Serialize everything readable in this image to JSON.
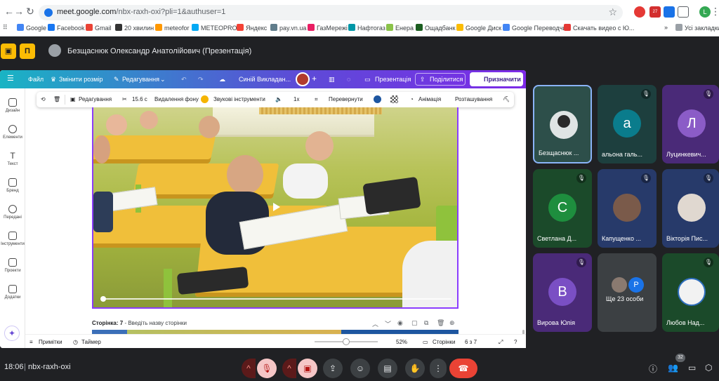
{
  "browser": {
    "url_host": "meet.google.com",
    "url_path": "/nbx-raxh-oxi?pli=1&authuser=1",
    "profile_initial": "L",
    "ext_badge": "27",
    "bookmarks": [
      "Google",
      "Facebook",
      "Gmail",
      "20 хвилин",
      "meteofor",
      "METEOPROG",
      "Яндекс",
      "pay.vn.ua",
      "ГазМережі",
      "Нафтогаз",
      "Енера",
      "Ощадбанк",
      "Google Диск",
      "Google Переводчик",
      "Скачать видео с Ю..."
    ],
    "more_bookmarks": "Усі закладки"
  },
  "meet": {
    "presenter": "Безщаснюк Олександр Анатолійович (Презентація)",
    "time": "18:06",
    "code": "nbx-raxh-oxi",
    "participants_count": "32"
  },
  "canva": {
    "menu": {
      "file": "Файл",
      "resize": "Змінити розмір",
      "edit": "Редагування",
      "project": "Синій Викладан...",
      "present": "Презентація",
      "share": "Поділитися",
      "assign": "Призначити"
    },
    "sidebar": [
      "Дизайн",
      "Елементи",
      "Текст",
      "Бренд",
      "Передані",
      "Інструменти",
      "Проекти",
      "Додатки"
    ],
    "toolbar": {
      "edit": "Редагування",
      "duration": "15.6 с",
      "remove_bg": "Видалення фону",
      "audio": "Звукові інструменти",
      "speed": "1x",
      "flip": "Перевернути",
      "animate": "Анімація",
      "position": "Розташування"
    },
    "page": {
      "label": "Сторінка: 7",
      "title_hint": "Введіть назву сторінки"
    },
    "bottom": {
      "notes": "Примітки",
      "timer": "Таймер",
      "zoom": "52%",
      "pages": "Сторінки",
      "page_count": "6 з 7"
    }
  },
  "tiles": [
    {
      "name": "Безщаснюк ...",
      "type": "photo",
      "color": "#2d4f4a",
      "muted": false,
      "active": true
    },
    {
      "name": "альона галь...",
      "initial": "а",
      "color": "#0a7c8c",
      "bg": "#1d3f3e",
      "muted": true
    },
    {
      "name": "Луцинкевич...",
      "initial": "Л",
      "color": "#8b5cc7",
      "bg": "#4a2a78",
      "muted": true
    },
    {
      "name": "Светлана Д...",
      "initial": "С",
      "color": "#1e8e3e",
      "bg": "#1b4a2a",
      "muted": true
    },
    {
      "name": "Капущенко ...",
      "type": "photo",
      "color": "#5a4a45",
      "bg": "#273a6a",
      "muted": true
    },
    {
      "name": "Вікторія Пис...",
      "type": "photo",
      "color": "#3a3030",
      "bg": "#273a6a",
      "muted": true
    },
    {
      "name": "Вирова Юлія",
      "initial": "В",
      "color": "#7a4fc4",
      "bg": "#4a2a78",
      "muted": true
    },
    {
      "name": "Ще 23 особи",
      "type": "more",
      "initial2": "P",
      "bg": "#3c4043"
    },
    {
      "name": "Любов Над...",
      "type": "photo",
      "color": "#4a5a6a",
      "bg": "#1b4a2a",
      "muted": true
    }
  ]
}
